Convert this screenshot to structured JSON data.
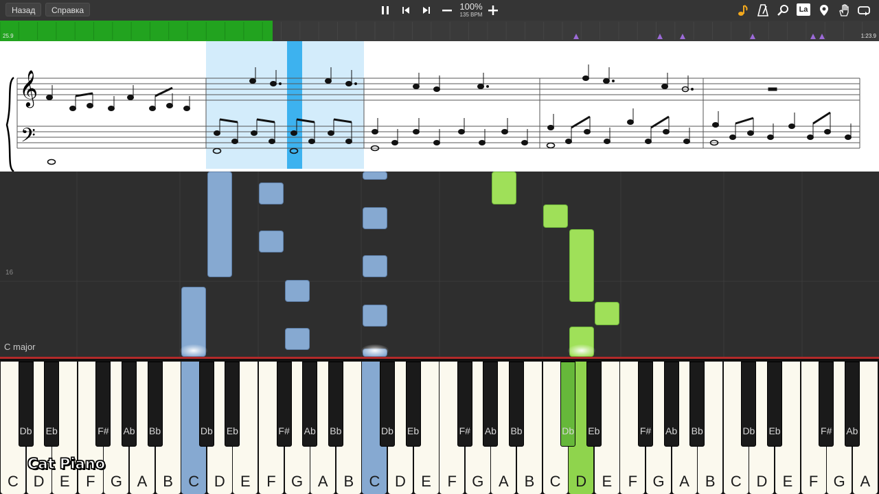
{
  "toolbar": {
    "back_label": "Назад",
    "help_label": "Справка",
    "zoom": "100%",
    "bpm": "135 BPM",
    "icons": [
      "pause-icon",
      "prev-icon",
      "next-icon",
      "minus-icon",
      "plus-icon",
      "note-icon",
      "metronome-icon",
      "magnifier-icon",
      "la-icon",
      "location-pin-icon",
      "hand-icon",
      "loop-icon"
    ],
    "la_label": "La"
  },
  "timeline": {
    "start_time": "25.9",
    "end_time": "1:23.9",
    "progress": 0.31,
    "progress_color": "#22a31f",
    "marker_color": "#9c6ad8"
  },
  "roll": {
    "measure_number": "16",
    "key_signature": "C major",
    "left_hand_color": "#86a9d1",
    "right_hand_color": "#9fe059"
  },
  "keyboard": {
    "white_labels": [
      "C",
      "D",
      "E",
      "F",
      "G",
      "A",
      "B",
      "C",
      "D",
      "E",
      "F",
      "G",
      "A",
      "B",
      "C",
      "D",
      "E",
      "F",
      "G",
      "A",
      "B",
      "C",
      "D",
      "E",
      "F",
      "G",
      "A",
      "B",
      "C",
      "D",
      "E",
      "F",
      "G",
      "A"
    ],
    "black_labels": [
      "Db",
      "Eb",
      "F#",
      "Ab",
      "Bb",
      "Db",
      "Eb",
      "F#",
      "Ab",
      "Bb",
      "Db",
      "Eb",
      "F#",
      "Ab",
      "Bb",
      "Db",
      "Eb",
      "F#",
      "Ab",
      "Bb",
      "Db",
      "Eb",
      "F#",
      "Ab"
    ],
    "pressed": [
      "C",
      "C",
      "D"
    ]
  },
  "watermark": "Cat Piano"
}
